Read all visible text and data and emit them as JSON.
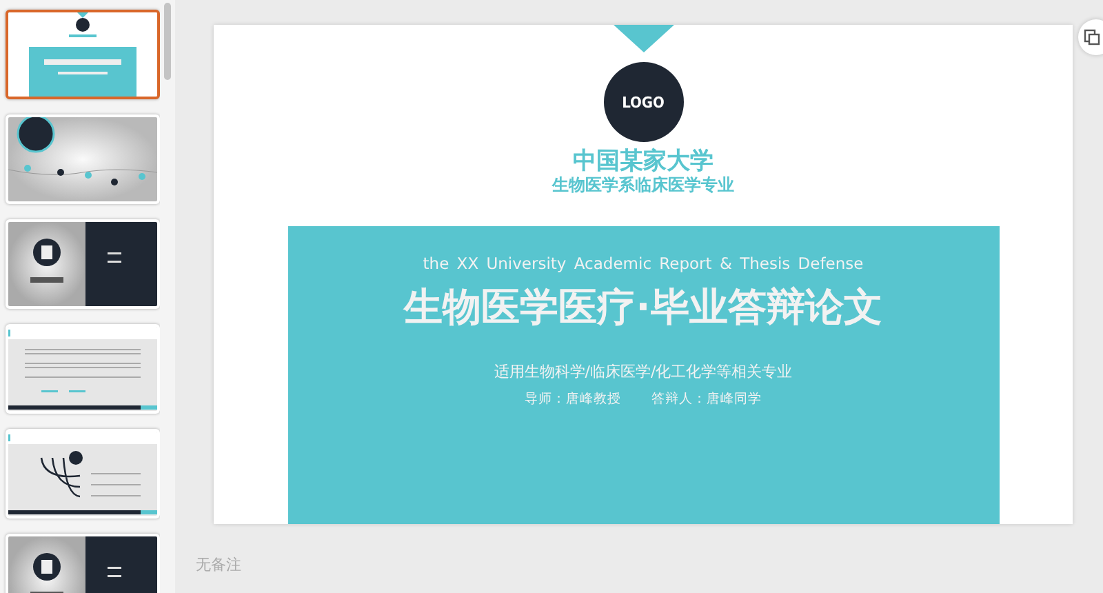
{
  "thumbnails": [
    {
      "kind": "cover",
      "selected": true
    },
    {
      "kind": "contents",
      "selected": false
    },
    {
      "kind": "section",
      "selected": false
    },
    {
      "kind": "text",
      "selected": false
    },
    {
      "kind": "diagram",
      "selected": false
    },
    {
      "kind": "section",
      "selected": false
    }
  ],
  "slide": {
    "logo": "LOGO",
    "university": "中国某家大学",
    "department": "生物医学系临床医学专业",
    "subtitle_en": "the XX University Academic Report & Thesis Defense",
    "title": "生物医学医疗·毕业答辩论文",
    "scope": "适用生物科学/临床医学/化工化学等相关专业",
    "advisor": "导师：唐峰教授",
    "defender": "答辩人：唐峰同学"
  },
  "notes": {
    "placeholder": "无备注"
  }
}
